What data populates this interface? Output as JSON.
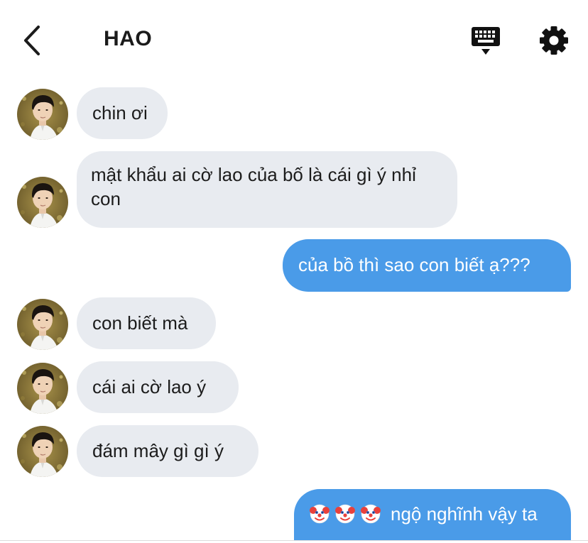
{
  "header": {
    "title": "HAO",
    "back_icon": "chevron-left-icon",
    "keyboard_icon": "keyboard-icon",
    "settings_icon": "gear-icon"
  },
  "colors": {
    "incoming_bubble": "#e8ebf0",
    "outgoing_bubble": "#4a9be8",
    "text": "#1c1c1c"
  },
  "messages": [
    {
      "direction": "incoming",
      "text": "chin ơi"
    },
    {
      "direction": "incoming",
      "text": "mật khẩu ai cờ lao của bố là cái gì ý nhỉ con"
    },
    {
      "direction": "outgoing",
      "text": "của bồ thì sao con biết ạ???"
    },
    {
      "direction": "incoming",
      "text": "con biết mà"
    },
    {
      "direction": "incoming",
      "text": "cái ai cờ lao ý"
    },
    {
      "direction": "incoming",
      "text": "đám mây gì gì ý"
    },
    {
      "direction": "outgoing",
      "text": "ngộ nghĩnh vậy ta",
      "emoji": [
        "clown-face",
        "clown-face",
        "clown-face"
      ]
    }
  ]
}
